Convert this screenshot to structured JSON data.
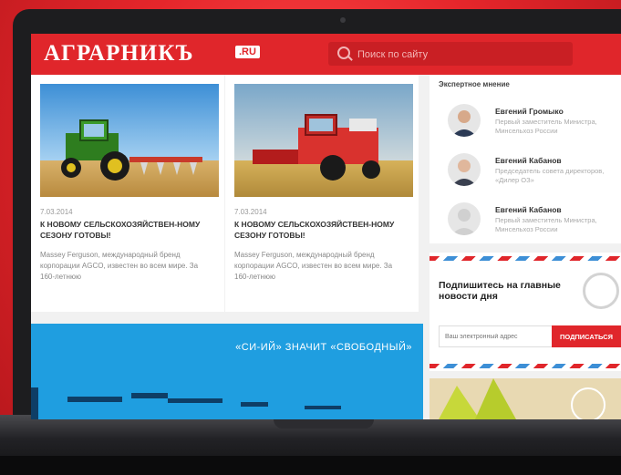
{
  "header": {
    "logo": "АГРАРНИКЪ",
    "logo_badge": ".RU",
    "search_placeholder": "Поиск по сайту"
  },
  "articles": [
    {
      "date": "7.03.2014",
      "title": "К НОВОМУ СЕЛЬСКОХОЗЯЙСТВЕН-НОМУ СЕЗОНУ ГОТОВЫ!",
      "text": "Massey Ferguson, международный бренд корпорации AGCO, известен во всем мире. За 160-летнюю"
    },
    {
      "date": "7.03.2014",
      "title": "К НОВОМУ СЕЛЬСКОХОЗЯЙСТВЕН-НОМУ СЕЗОНУ ГОТОВЫ!",
      "text": "Massey Ferguson, международный бренд корпорации AGCO, известен во всем мире. За 160-летнюю"
    }
  ],
  "banner": {
    "text": "«СИ-ИЙ» ЗНАЧИТ «СВОБОДНЫЙ»"
  },
  "experts": {
    "title": "Экспертное мнение",
    "items": [
      {
        "name": "Евгений Громыко",
        "role": "Первый заместитель Министра, Минсельхоз России"
      },
      {
        "name": "Евгений Кабанов",
        "role": "Председатель совета директоров, «Дилер ОЗ»"
      },
      {
        "name": "Евгений Кабанов",
        "role": "Первый заместитель Министра, Минсельхоз России"
      }
    ]
  },
  "subscribe": {
    "title": "Подпишитесь на главные новости дня",
    "email_placeholder": "Ваш электронный адрес",
    "button": "ПОДПИСАТЬСЯ"
  },
  "colors": {
    "brand_red": "#e0262b",
    "banner_blue": "#1f9ee0"
  }
}
